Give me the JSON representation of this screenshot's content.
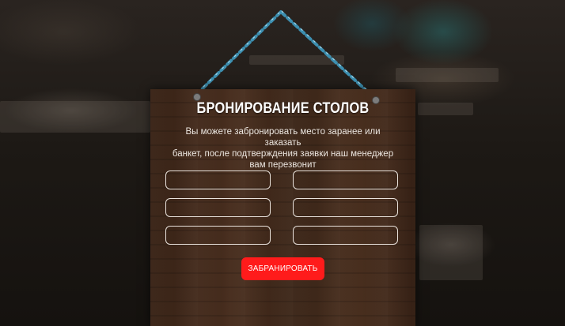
{
  "booking": {
    "title": "БРОНИРОВАНИЕ СТОЛОВ",
    "description_lines": [
      "Вы можете забронировать место заранее или заказать",
      "банкет, после подтверждения заявки наш менеджер",
      "вам перезвонит"
    ],
    "fields": [
      {
        "value": "",
        "placeholder": ""
      },
      {
        "value": "",
        "placeholder": ""
      },
      {
        "value": "",
        "placeholder": ""
      },
      {
        "value": "",
        "placeholder": ""
      },
      {
        "value": "",
        "placeholder": ""
      },
      {
        "value": "",
        "placeholder": ""
      }
    ],
    "submit_label": "ЗАБРАНИРОВАТЬ"
  },
  "colors": {
    "accent": "#ff1b1b",
    "board": "#4a2f1f",
    "chain": "#3d8fb0"
  },
  "icons": {
    "chain": "chain-icon",
    "nail": "nail-icon"
  }
}
